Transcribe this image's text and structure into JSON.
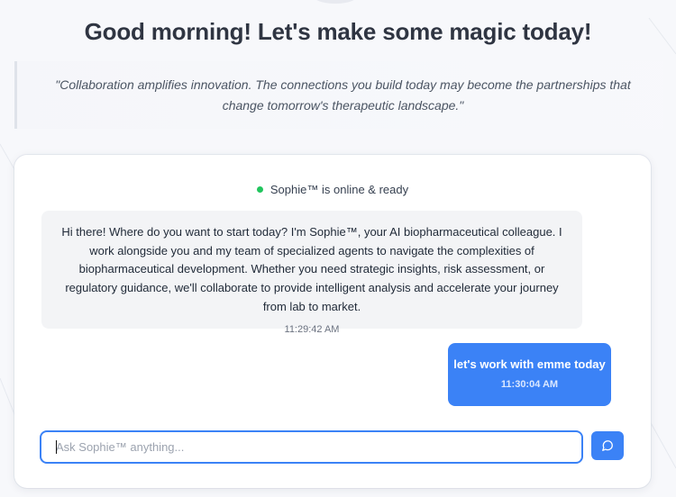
{
  "greeting": "Good morning! Let's make some magic today!",
  "quote": "\"Collaboration amplifies innovation. The connections you build today may become the partnerships that change tomorrow's therapeutic landscape.\"",
  "chat": {
    "status_text": "Sophie™ is online & ready",
    "status_color": "#22c55e",
    "messages": [
      {
        "role": "assistant",
        "text": "Hi there! Where do you want to start today? I'm Sophie™, your AI biopharmaceutical colleague. I work alongside you and my team of specialized agents to navigate the complexities of biopharmaceutical development. Whether you need strategic insights, risk assessment, or regulatory guidance, we'll collaborate to provide intelligent analysis and accelerate your journey from lab to market.",
        "time": "11:29:42 AM"
      },
      {
        "role": "user",
        "text": "let's work with emme today",
        "time": "11:30:04 AM"
      }
    ],
    "input": {
      "value": "",
      "placeholder": "Ask Sophie™ anything..."
    },
    "send_icon": "chat-bubble-icon"
  },
  "colors": {
    "accent": "#3b82f6",
    "assistant_bubble": "#f3f4f6",
    "background": "#f7f8fb"
  }
}
